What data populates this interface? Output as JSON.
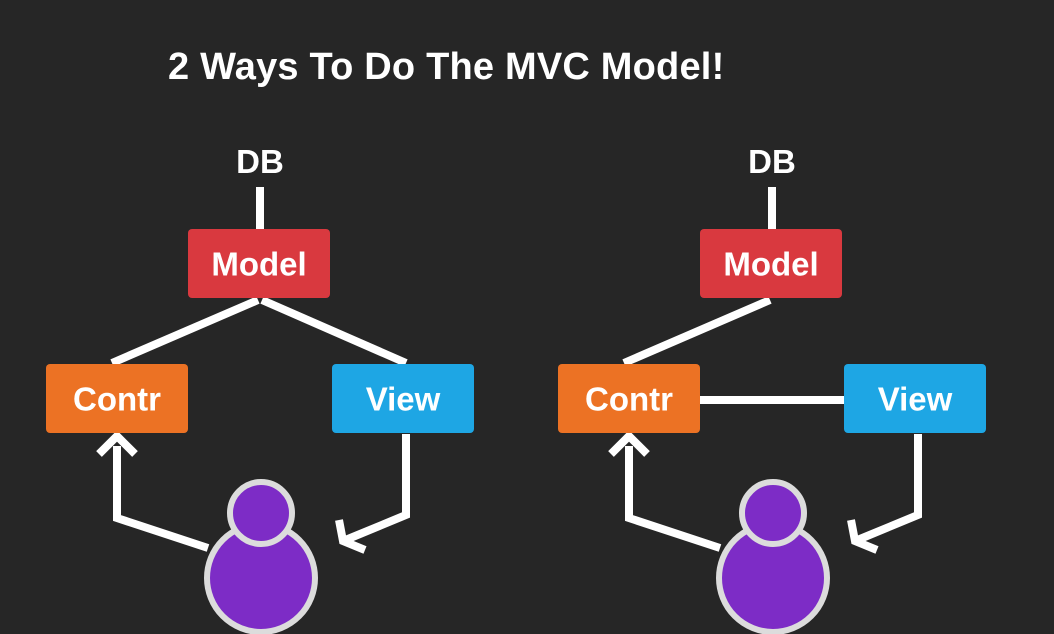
{
  "title": "2 Ways To Do The MVC Model!",
  "colors": {
    "background": "#262626",
    "model": "#d9393f",
    "controller": "#ec7224",
    "view": "#1ea6e4",
    "user_fill": "#7d2cc6",
    "user_outline": "#dcdcdc",
    "lines": "#ffffff"
  },
  "diagrams": [
    {
      "db_label": "DB",
      "model_label": "Model",
      "controller_label": "Contr",
      "view_label": "View",
      "user_icon": "user-icon",
      "controller_view_link": false
    },
    {
      "db_label": "DB",
      "model_label": "Model",
      "controller_label": "Contr",
      "view_label": "View",
      "user_icon": "user-icon",
      "controller_view_link": true
    }
  ]
}
